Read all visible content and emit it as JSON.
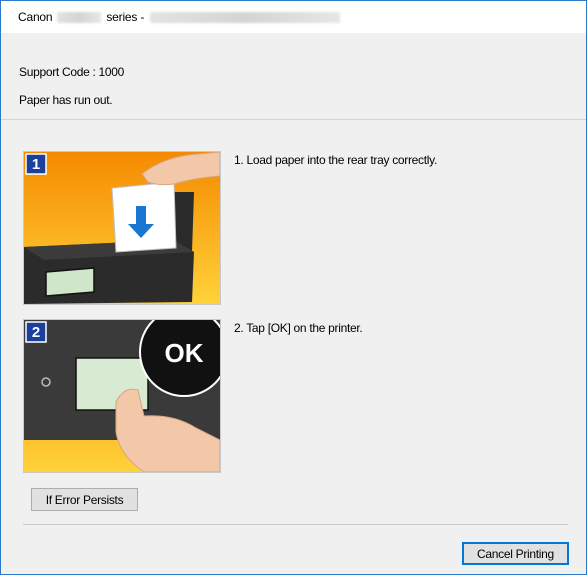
{
  "titlebar": {
    "brand": "Canon",
    "series": "series -"
  },
  "status": {
    "support_code": "Support Code : 1000",
    "message": "Paper has run out."
  },
  "steps": [
    {
      "number": "1",
      "text": "1.  Load paper into the rear tray correctly.",
      "icon": "load-paper-illustration"
    },
    {
      "number": "2",
      "text": "2.  Tap [OK] on the printer.",
      "icon": "tap-ok-illustration",
      "overlay_text": "OK"
    }
  ],
  "buttons": {
    "if_error_persists": "If Error Persists",
    "cancel_printing": "Cancel Printing"
  },
  "colors": {
    "accent": "#0078d7",
    "illustration_orange": "#f6a000",
    "step_badge": "#1a3f9c"
  }
}
